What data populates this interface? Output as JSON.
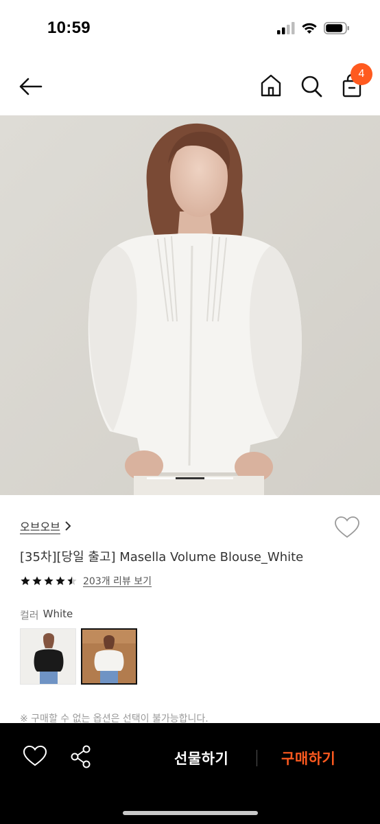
{
  "status_bar": {
    "time": "10:59"
  },
  "nav": {
    "cart_count": "4"
  },
  "product": {
    "brand": "오브오브",
    "title": "[35차][당일 출고] Masella Volume Blouse_White",
    "rating": 4.5,
    "review_link": "203개 리뷰 보기",
    "color_label": "컬러",
    "color_value": "White",
    "image_count": 3,
    "current_image_index": 2,
    "options": [
      {
        "name": "Black",
        "selected": false
      },
      {
        "name": "White",
        "selected": true
      }
    ],
    "notice": "※ 구매할 수 없는 옵션은 선택이 불가능합니다."
  },
  "bottom_bar": {
    "gift_label": "선물하기",
    "buy_label": "구매하기"
  },
  "colors": {
    "accent": "#ff5a1f",
    "bottom_bar_bg": "#000000"
  },
  "icons": [
    "back-arrow-icon",
    "home-icon",
    "search-icon",
    "cart-icon",
    "heart-icon",
    "share-icon",
    "chevron-right-icon",
    "star-icon"
  ]
}
